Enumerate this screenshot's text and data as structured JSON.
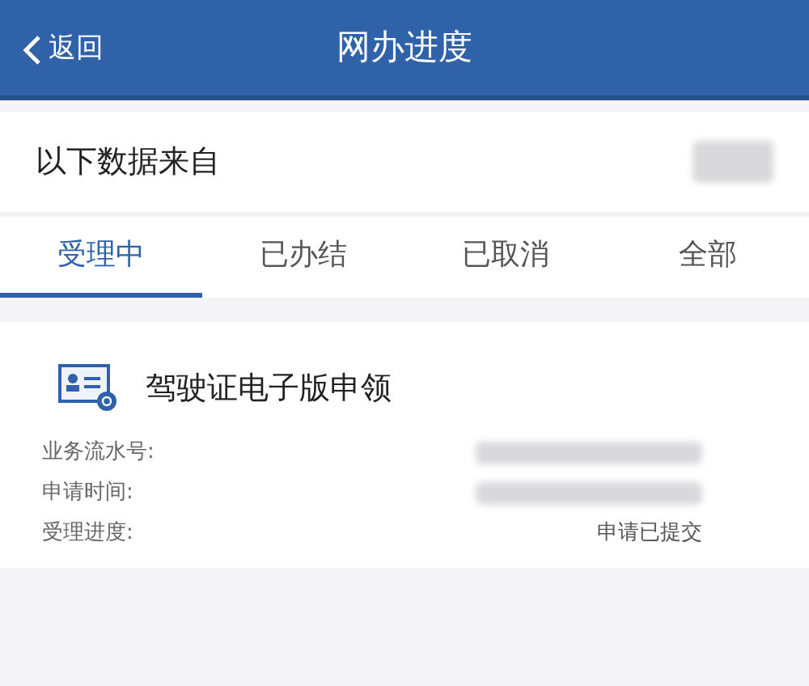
{
  "header": {
    "back_label": "返回",
    "title": "网办进度"
  },
  "source": {
    "label": "以下数据来自",
    "kind": "redacted"
  },
  "tabs": [
    {
      "label": "受理中",
      "selected": true
    },
    {
      "label": "已办结",
      "selected": false
    },
    {
      "label": "已取消",
      "selected": false
    },
    {
      "label": "全部",
      "selected": false
    }
  ],
  "card": {
    "title": "驾驶证电子版申领",
    "fields": [
      {
        "label": "业务流水号:",
        "kind": "redacted"
      },
      {
        "label": "申请时间:",
        "kind": "redacted"
      },
      {
        "label": "受理进度:",
        "kind": "text",
        "value": "申请已提交"
      }
    ]
  }
}
